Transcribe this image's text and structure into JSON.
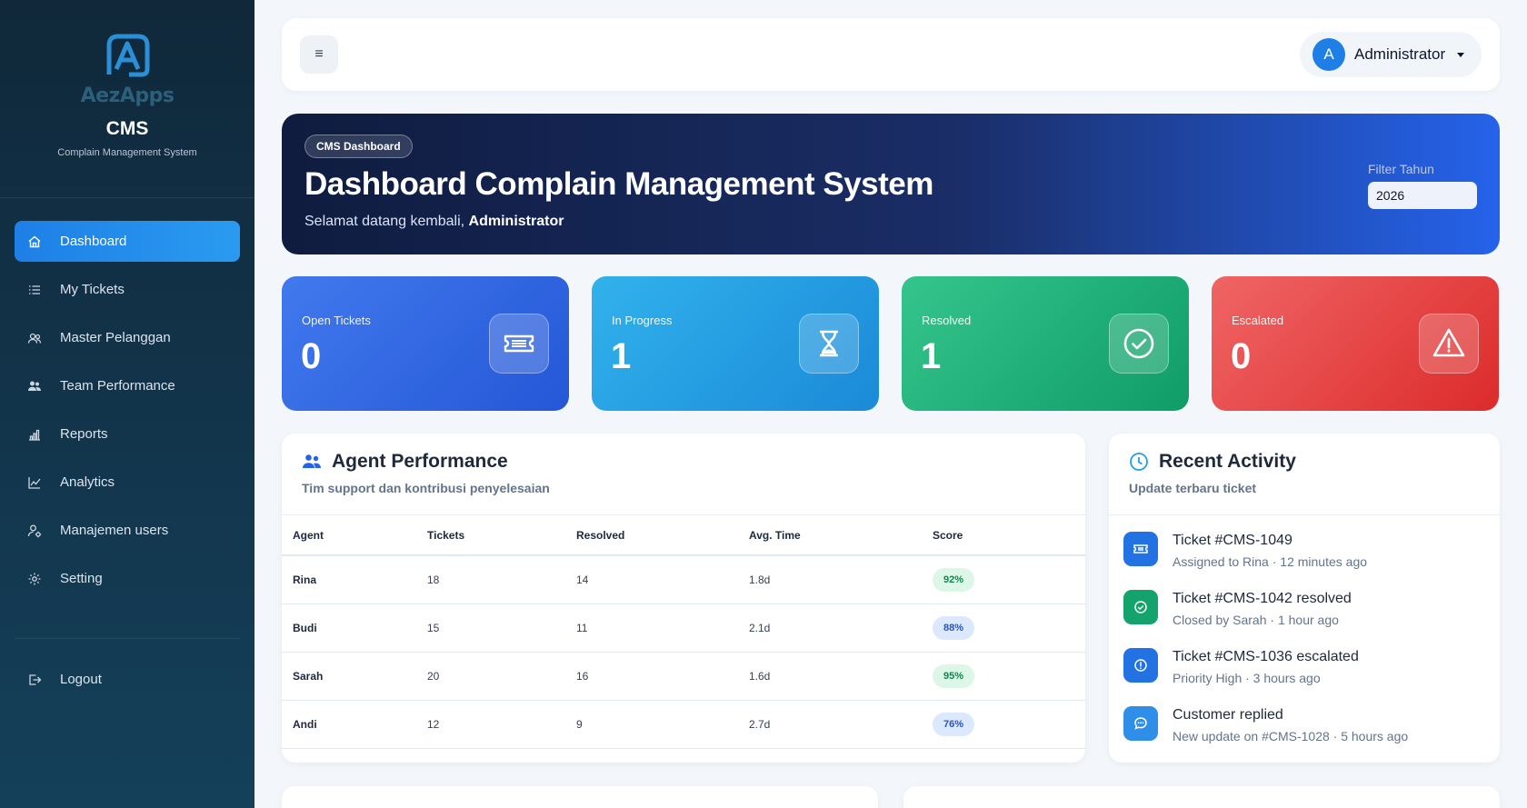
{
  "sidebar": {
    "logo_text": "AezApps",
    "app_name": "CMS",
    "app_subtitle": "Complain Management System",
    "items": [
      {
        "label": "Dashboard",
        "icon": "home-icon"
      },
      {
        "label": "My Tickets",
        "icon": "list-icon"
      },
      {
        "label": "Master Pelanggan",
        "icon": "users-icon"
      },
      {
        "label": "Team Performance",
        "icon": "team-icon"
      },
      {
        "label": "Reports",
        "icon": "bar-chart-icon"
      },
      {
        "label": "Analytics",
        "icon": "line-chart-icon"
      },
      {
        "label": "Manajemen users",
        "icon": "user-gear-icon"
      },
      {
        "label": "Setting",
        "icon": "gear-icon"
      }
    ],
    "logout_label": "Logout"
  },
  "topbar": {
    "menu_icon": "≡",
    "user_initial": "A",
    "user_name": "Administrator"
  },
  "hero": {
    "badge": "CMS Dashboard",
    "title": "Dashboard Complain Management System",
    "welcome_prefix": "Selamat datang kembali, ",
    "welcome_name": "Administrator",
    "filter_label": "Filter Tahun",
    "filter_value": "2026"
  },
  "stats": [
    {
      "label": "Open Tickets",
      "value": "0",
      "icon": "ticket-icon",
      "color": "#2f66e3"
    },
    {
      "label": "In Progress",
      "value": "1",
      "icon": "hourglass-icon",
      "color": "#24a0e3"
    },
    {
      "label": "Resolved",
      "value": "1",
      "icon": "check-circle-icon",
      "color": "#1fad77"
    },
    {
      "label": "Escalated",
      "value": "0",
      "icon": "warning-icon",
      "color": "#e63d3d"
    }
  ],
  "agent_performance": {
    "title": "Agent Performance",
    "subtitle": "Tim support dan kontribusi penyelesaian",
    "columns": [
      "Agent",
      "Tickets",
      "Resolved",
      "Avg. Time",
      "Score"
    ],
    "rows": [
      {
        "agent": "Rina",
        "tickets": "18",
        "resolved": "14",
        "avg_time": "1.8d",
        "score": "92%",
        "tone": "green"
      },
      {
        "agent": "Budi",
        "tickets": "15",
        "resolved": "11",
        "avg_time": "2.1d",
        "score": "88%",
        "tone": "blue"
      },
      {
        "agent": "Sarah",
        "tickets": "20",
        "resolved": "16",
        "avg_time": "1.6d",
        "score": "95%",
        "tone": "green"
      },
      {
        "agent": "Andi",
        "tickets": "12",
        "resolved": "9",
        "avg_time": "2.7d",
        "score": "76%",
        "tone": "blue"
      }
    ]
  },
  "recent_activity": {
    "title": "Recent Activity",
    "subtitle": "Update terbaru ticket",
    "items": [
      {
        "title": "Ticket #CMS-1049",
        "meta": "Assigned to Rina · 12 minutes ago",
        "icon": "ticket-icon",
        "color": "#2272e4"
      },
      {
        "title": "Ticket #CMS-1042 resolved",
        "meta": "Closed by Sarah · 1 hour ago",
        "icon": "check-circle-icon",
        "color": "#14a36c"
      },
      {
        "title": "Ticket #CMS-1036 escalated",
        "meta": "Priority High · 3 hours ago",
        "icon": "alert-circle-icon",
        "color": "#2272e4"
      },
      {
        "title": "Customer replied",
        "meta": "New update on #CMS-1028 · 5 hours ago",
        "icon": "chat-icon",
        "color": "#2f8fe8"
      }
    ]
  }
}
